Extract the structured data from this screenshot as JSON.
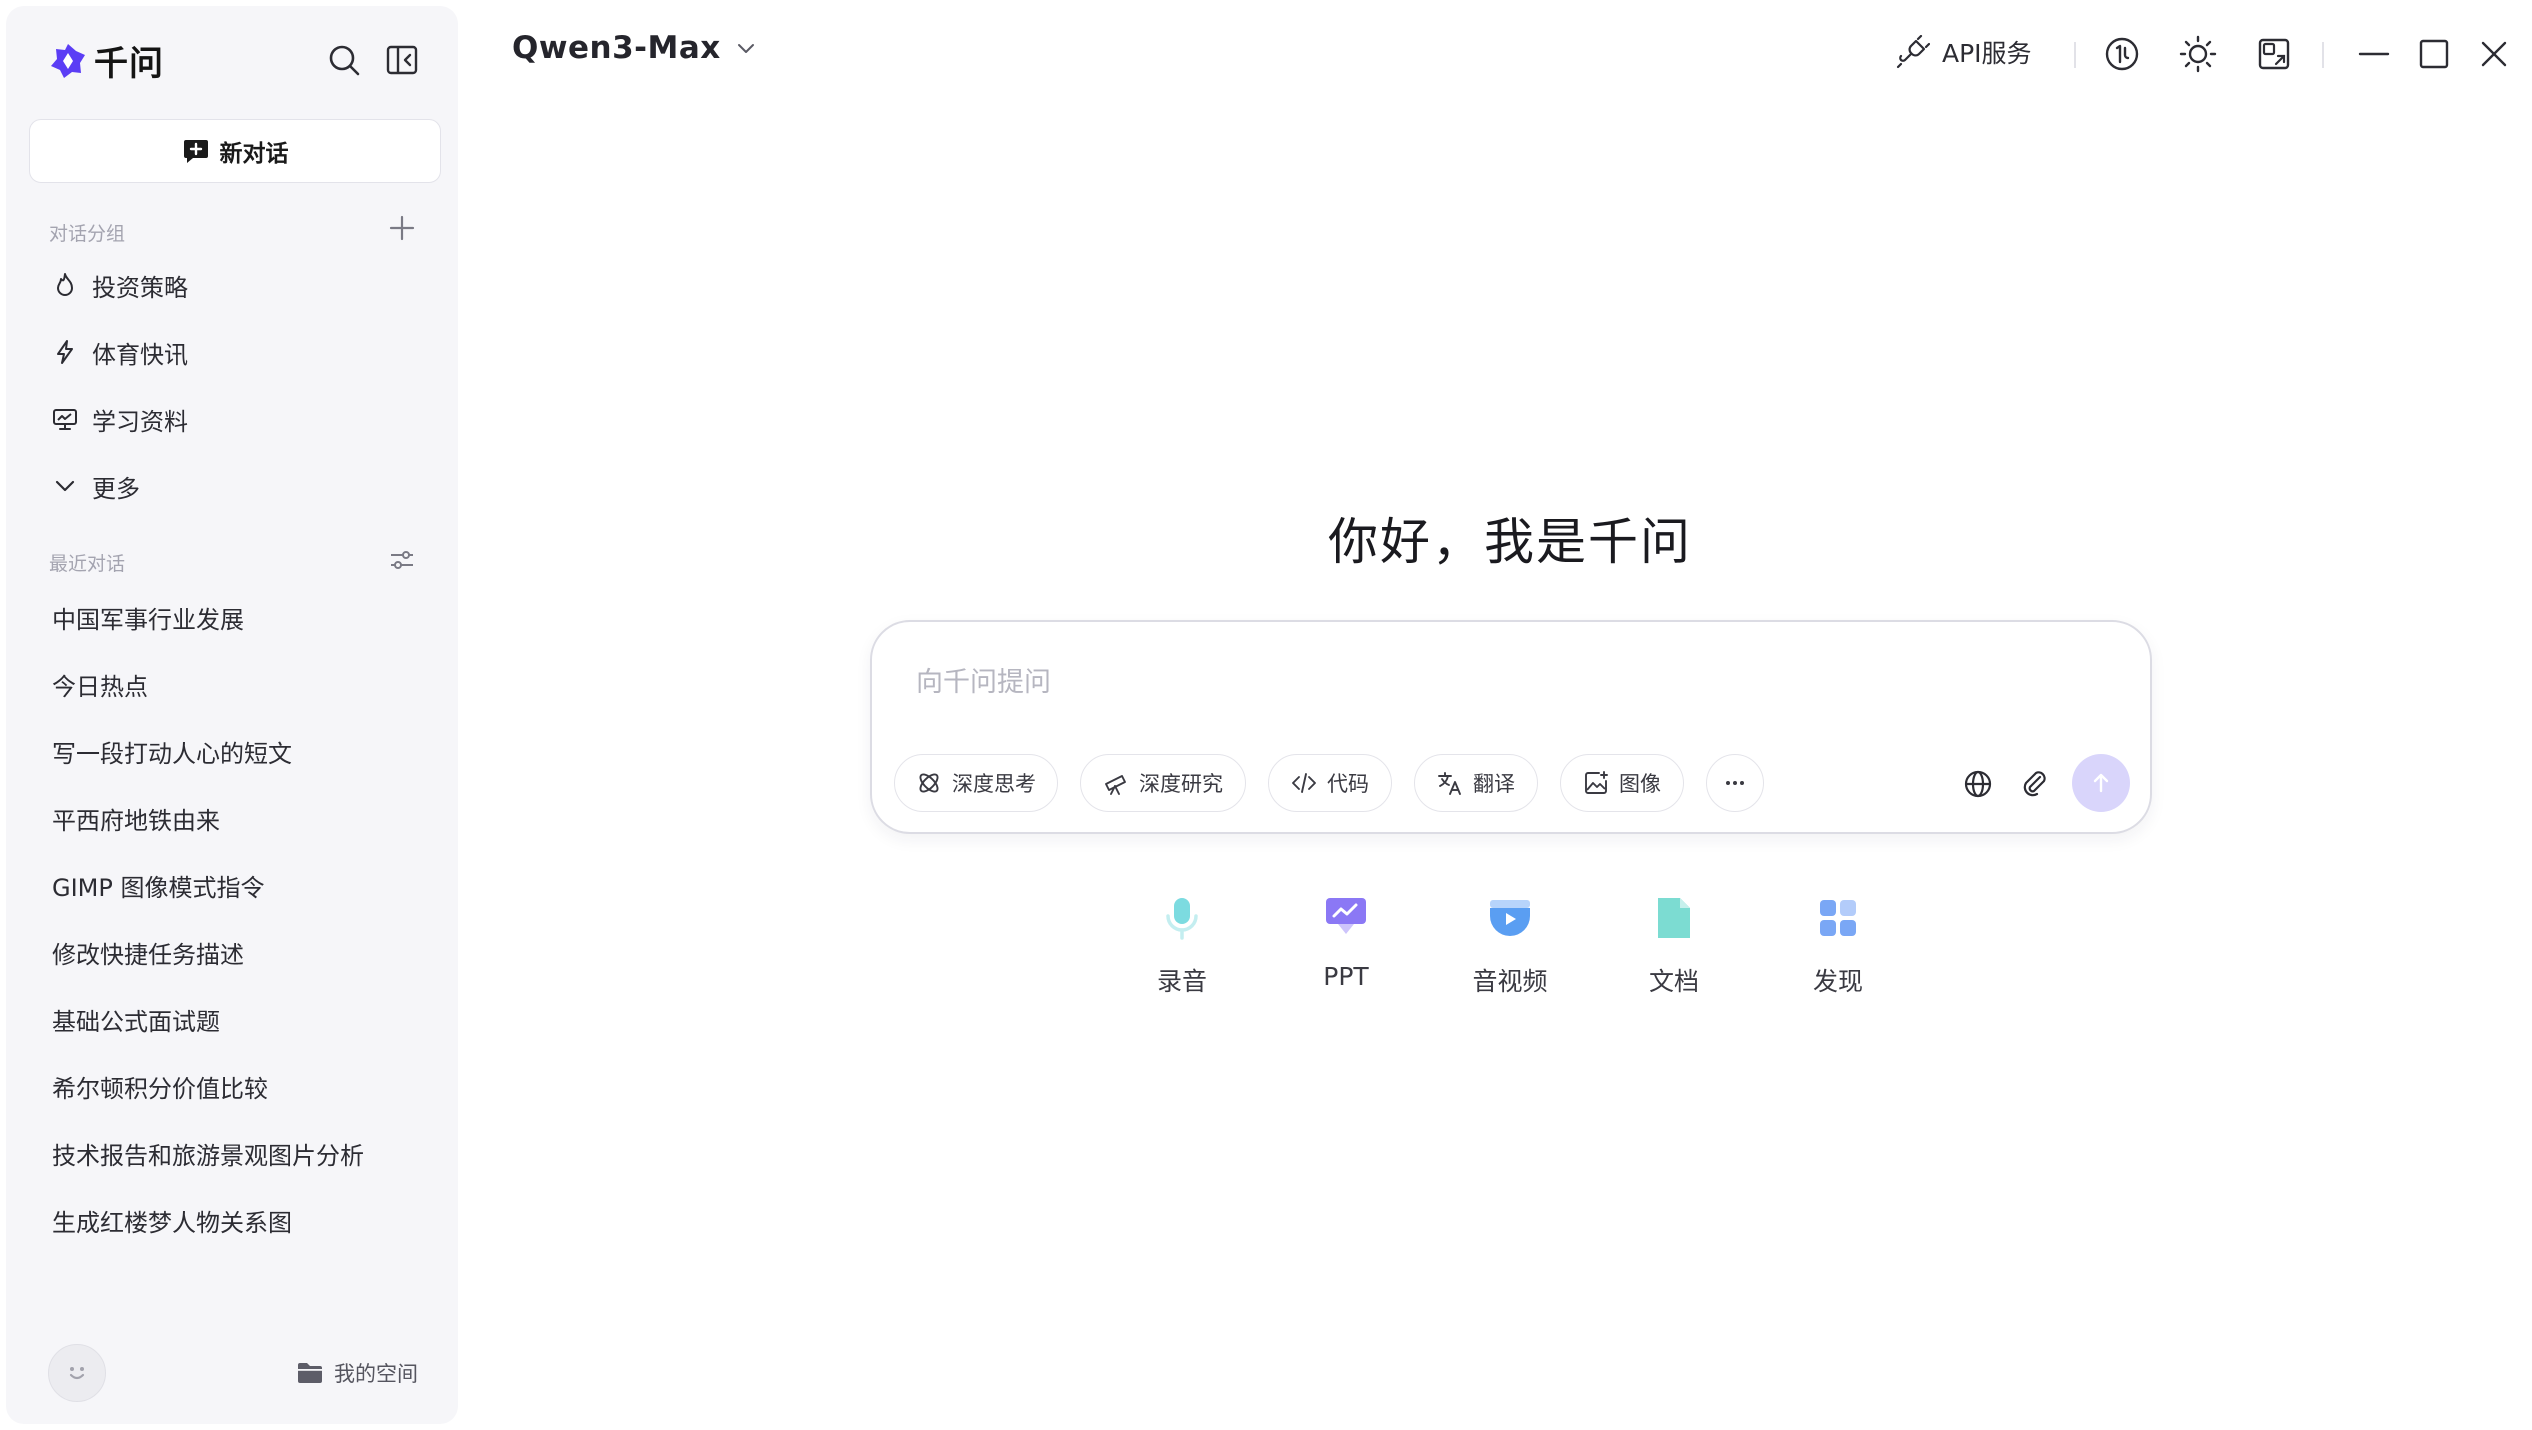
{
  "app": {
    "name": "千问"
  },
  "sidebar": {
    "new_chat_label": "新对话",
    "groups_label": "对话分组",
    "groups": [
      {
        "label": "投资策略",
        "icon": "fire-icon"
      },
      {
        "label": "体育快讯",
        "icon": "lightning-icon"
      },
      {
        "label": "学习资料",
        "icon": "presentation-icon"
      },
      {
        "label": "更多",
        "icon": "chevron-down-icon"
      }
    ],
    "recent_label": "最近对话",
    "recent": [
      "中国军事行业发展",
      "今日热点",
      "写一段打动人心的短文",
      "平西府地铁由来",
      "GIMP 图像模式指令",
      "修改快捷任务描述",
      "基础公式面试题",
      "希尔顿积分价值比较",
      "技术报告和旅游景观图片分析",
      "生成红楼梦人物关系图"
    ],
    "my_space_label": "我的空间"
  },
  "topbar": {
    "model": "Qwen3-Max",
    "api_label": "API服务"
  },
  "main": {
    "greeting": "你好，我是千问",
    "input_placeholder": "向千问提问",
    "chips": [
      "深度思考",
      "深度研究",
      "代码",
      "翻译",
      "图像"
    ],
    "quick_actions": [
      "录音",
      "PPT",
      "音视频",
      "文档",
      "发现"
    ]
  },
  "colors": {
    "brand": "#5b3df5",
    "send_bg": "#d9d5fb",
    "sidebar_bg": "#f6f6f9"
  }
}
